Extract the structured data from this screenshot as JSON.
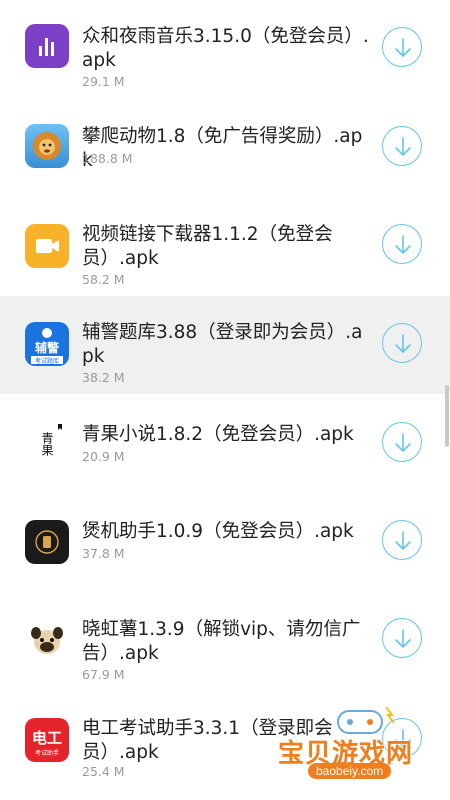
{
  "apps": [
    {
      "title": "众和夜雨音乐3.15.0（免登会员）.apk",
      "size": "29.1 M",
      "icon": "bar-chart-music-icon",
      "color": "#7b3fc8"
    },
    {
      "title": "攀爬动物1.8（免广告得奖励）.apk",
      "size": "188.8 M",
      "icon": "lion-game-icon",
      "color": "#3b8fd6"
    },
    {
      "title": "视频链接下载器1.1.2（免登会员）.apk",
      "size": "58.2 M",
      "icon": "video-camera-icon",
      "color": "#f8b22a"
    },
    {
      "title": "辅警题库3.88（登录即为会员）.apk",
      "size": "38.2 M",
      "icon": "police-quiz-icon",
      "color": "#1b73e0",
      "icon_text": "辅警",
      "icon_sub": "考试题库"
    },
    {
      "title": "青果小说1.8.2（免登会员）.apk",
      "size": "20.9 M",
      "icon": "qingguo-novel-icon",
      "color": "#ffffff",
      "icon_text": "青果"
    },
    {
      "title": "煲机助手1.0.9（免登会员）.apk",
      "size": "37.8 M",
      "icon": "speaker-icon",
      "color": "#1a1a1a"
    },
    {
      "title": "晓虹薯1.3.9（解锁vip、请勿信广告）.apk",
      "size": "67.9 M",
      "icon": "pug-dog-icon",
      "color": "#ffffff"
    },
    {
      "title": "电工考试助手3.3.1（登录即会员）.apk",
      "size": "25.4 M",
      "icon": "electrician-exam-icon",
      "color": "#e4232b",
      "icon_text": "电工",
      "icon_sub": "考试助手"
    }
  ],
  "watermark": {
    "name": "宝贝游戏网",
    "url": "baobeiy.com"
  },
  "accent": "#64c4e9"
}
